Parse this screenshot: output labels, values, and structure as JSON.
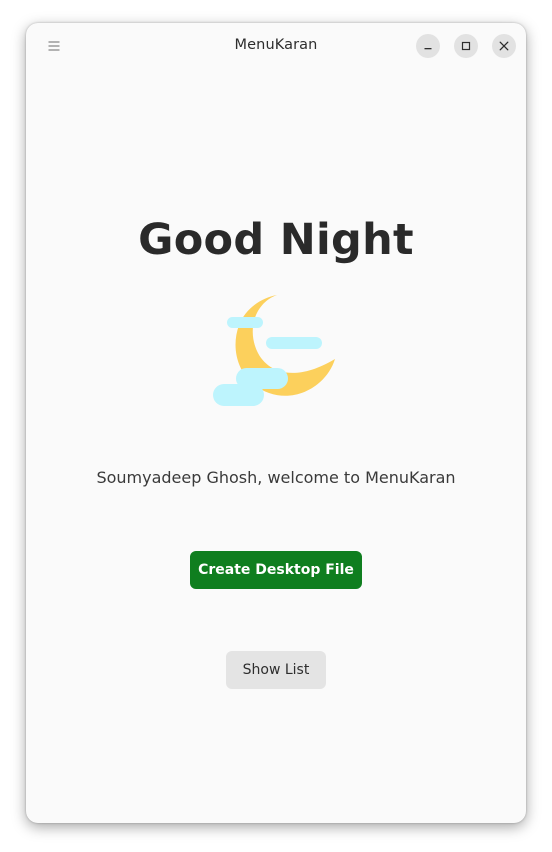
{
  "window": {
    "title": "MenuKaran"
  },
  "icons": {
    "menu": "hamburger-menu-icon",
    "minimize": "minimize-icon",
    "maximize": "maximize-icon",
    "close": "close-icon",
    "illustration": "moon-clouds-icon"
  },
  "main": {
    "greeting": "Good Night",
    "welcome": "Soumyadeep Ghosh, welcome to MenuKaran",
    "create_button": "Create Desktop File",
    "list_button": "Show List"
  },
  "colors": {
    "primary_button": "#0f7e1f",
    "moon": "#fcd05c",
    "cloud": "#bdf4fd"
  }
}
